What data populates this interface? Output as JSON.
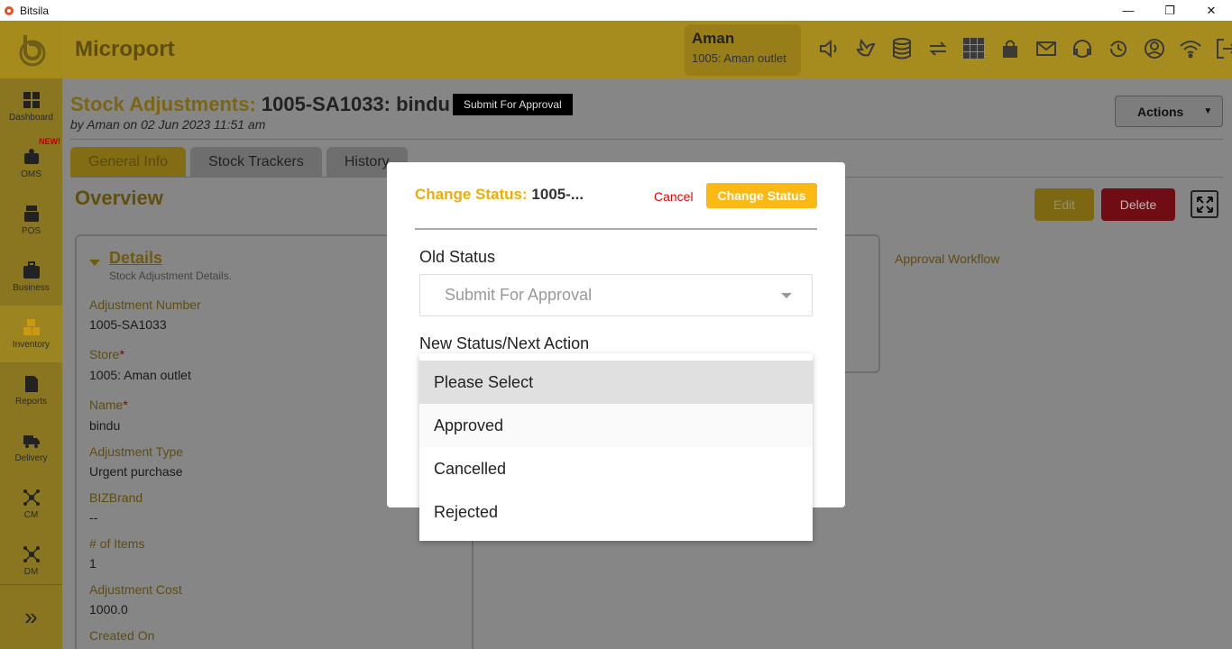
{
  "window": {
    "app_name": "Bitsila",
    "minimize": "—",
    "restore": "❐",
    "close": "✕"
  },
  "sidebar": {
    "items": [
      {
        "label": "Dashboard",
        "icon": "dashboard-icon"
      },
      {
        "label": "OMS",
        "icon": "oms-icon",
        "badge": "NEW!"
      },
      {
        "label": "POS",
        "icon": "pos-icon"
      },
      {
        "label": "Business",
        "icon": "briefcase-icon"
      },
      {
        "label": "Inventory",
        "icon": "boxes-icon",
        "active": true
      },
      {
        "label": "Reports",
        "icon": "report-icon"
      },
      {
        "label": "Delivery",
        "icon": "truck-icon"
      },
      {
        "label": "CM",
        "icon": "network-icon"
      },
      {
        "label": "DM",
        "icon": "network-icon"
      }
    ],
    "expand": "»"
  },
  "header": {
    "brand": "Microport",
    "user_name": "Aman",
    "user_store": "1005: Aman outlet"
  },
  "page": {
    "title_prefix": "Stock Adjustments:",
    "title_main": " 1005-SA1033: bindu",
    "status_chip": "Submit For Approval",
    "byline": "by Aman on 02 Jun 2023 11:51 am",
    "actions_label": "Actions",
    "tabs": [
      "General Info",
      "Stock Trackers",
      "History"
    ],
    "overview": "Overview",
    "edit_label": "Edit",
    "delete_label": "Delete",
    "approval_workflow": "Approval Workflow"
  },
  "details": {
    "title": "Details",
    "subtitle": "Stock Adjustment Details.",
    "fields": [
      {
        "label": "Adjustment Number",
        "value": "1005-SA1033",
        "required": false
      },
      {
        "label": "Store",
        "value": "1005: Aman outlet",
        "required": true
      },
      {
        "label": "Name",
        "value": "bindu",
        "required": true
      },
      {
        "label": "Adjustment Type",
        "value": "Urgent purchase",
        "required": false
      },
      {
        "label": "BIZBrand",
        "value": "--",
        "required": false
      },
      {
        "label": "# of Items",
        "value": "1",
        "required": false
      },
      {
        "label": "Adjustment Cost",
        "value": "1000.0",
        "required": false
      },
      {
        "label": "Created On",
        "value": "",
        "required": false
      }
    ]
  },
  "modal": {
    "title_prefix": "Change Status:",
    "title_main": " 1005-...",
    "cancel_label": "Cancel",
    "change_label": "Change Status",
    "old_status_label": "Old Status",
    "old_status_value": "Submit For Approval",
    "new_status_label": "New Status/Next Action",
    "options": [
      "Please Select",
      "Approved",
      "Cancelled",
      "Rejected"
    ]
  },
  "colors": {
    "accent": "#fdb913",
    "cancel": "#e00000",
    "sidebar": "#8a7620"
  }
}
